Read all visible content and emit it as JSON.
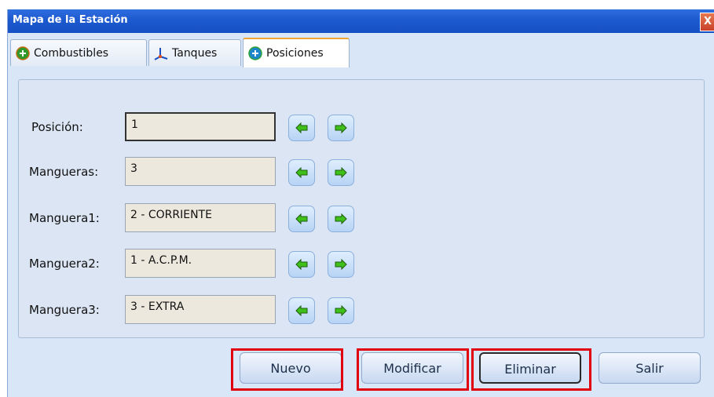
{
  "window": {
    "title": "Mapa de la Estación",
    "close_label": "X"
  },
  "tabs": [
    {
      "label": "Combustibles",
      "icon": "green-plus-circle-icon"
    },
    {
      "label": "Tanques",
      "icon": "axes-3d-icon"
    },
    {
      "label": "Posiciones",
      "icon": "blue-plus-circle-icon",
      "active": true
    }
  ],
  "fields": [
    {
      "label": "Posición:",
      "value": "1"
    },
    {
      "label": "Mangueras:",
      "value": "3"
    },
    {
      "label": "Manguera1:",
      "value": "2 - CORRIENTE"
    },
    {
      "label": "Manguera2:",
      "value": "1 - A.C.P.M."
    },
    {
      "label": "Manguera3:",
      "value": "3 - EXTRA"
    }
  ],
  "buttons": {
    "nuevo": "Nuevo",
    "modificar": "Modificar",
    "eliminar": "Eliminar",
    "salir": "Salir"
  },
  "colors": {
    "titlebar": "#1e5bd0",
    "highlight": "#e10010",
    "arrow_green": "#3fbf1a"
  }
}
